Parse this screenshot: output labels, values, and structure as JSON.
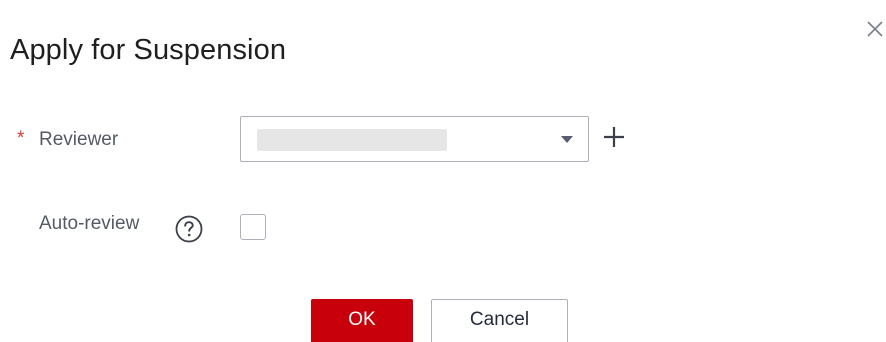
{
  "dialog": {
    "title": "Apply for Suspension",
    "close_icon": "close-icon"
  },
  "form": {
    "reviewer": {
      "required_mark": "*",
      "label": "Reviewer",
      "value": "",
      "dropdown_icon": "caret-down-icon",
      "add_icon": "plus-icon"
    },
    "auto_review": {
      "label": "Auto-review",
      "help_icon": "question-circle-icon",
      "checked": false
    }
  },
  "footer": {
    "ok_label": "OK",
    "cancel_label": "Cancel"
  },
  "colors": {
    "primary": "#c7000b",
    "required": "#e03b3b",
    "border": "#adb0b8",
    "label": "#555a66"
  }
}
